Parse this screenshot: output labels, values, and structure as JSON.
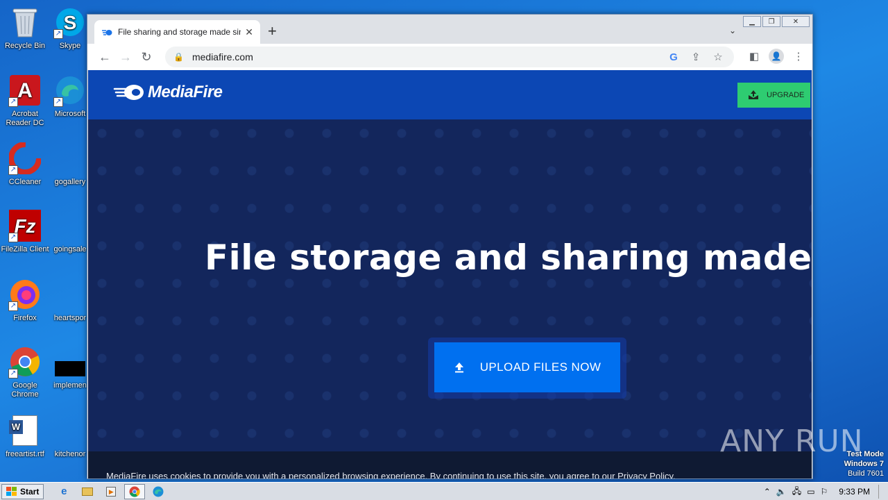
{
  "desktop": {
    "icons_col1": [
      {
        "label": "Recycle Bin",
        "icon": "recycle-bin-icon"
      },
      {
        "label": "Acrobat Reader DC",
        "icon": "acrobat-icon"
      },
      {
        "label": "CCleaner",
        "icon": "ccleaner-icon"
      },
      {
        "label": "FileZilla Client",
        "icon": "filezilla-icon"
      },
      {
        "label": "Firefox",
        "icon": "firefox-icon"
      },
      {
        "label": "Google Chrome",
        "icon": "chrome-icon"
      },
      {
        "label": "freeartist.rtf",
        "icon": "word-doc-icon"
      }
    ],
    "icons_col2": [
      {
        "label": "Skype",
        "icon": "skype-icon"
      },
      {
        "label": "Microsoft",
        "icon": "edge-icon"
      },
      {
        "label": "gogallery",
        "icon": "blank-file-icon"
      },
      {
        "label": "goingsale",
        "icon": "blank-file-icon"
      },
      {
        "label": "heartspor",
        "icon": "blank-file-icon"
      },
      {
        "label": "implemen",
        "icon": "black-thumbnail-icon"
      },
      {
        "label": "kitchenor",
        "icon": "blank-file-icon"
      }
    ]
  },
  "browser": {
    "tab_title": "File sharing and storage made simple",
    "url": "mediafire.com",
    "colors": {
      "tab_bar": "#dee1e6",
      "toolbar": "#ffffff",
      "omnibox": "#f1f3f4"
    }
  },
  "mediafire": {
    "logo_text": "MediaFire",
    "upgrade_label": "UPGRADE",
    "hero_title": "File storage and sharing made simple",
    "upload_label": "UPLOAD FILES NOW",
    "cookie_text": "MediaFire uses cookies to provide you with a personalized browsing experience. By continuing to use this site, you agree to our Privacy Policy.",
    "colors": {
      "header": "#0c47b4",
      "hero": "#13265c",
      "upload": "#0070f0",
      "upgrade": "#2ecc71"
    }
  },
  "watermark": {
    "text": "ANY RUN",
    "test_mode": "Test Mode",
    "os": "Windows 7",
    "build": "Build 7601"
  },
  "taskbar": {
    "start_label": "Start",
    "clock": "9:33 PM"
  }
}
